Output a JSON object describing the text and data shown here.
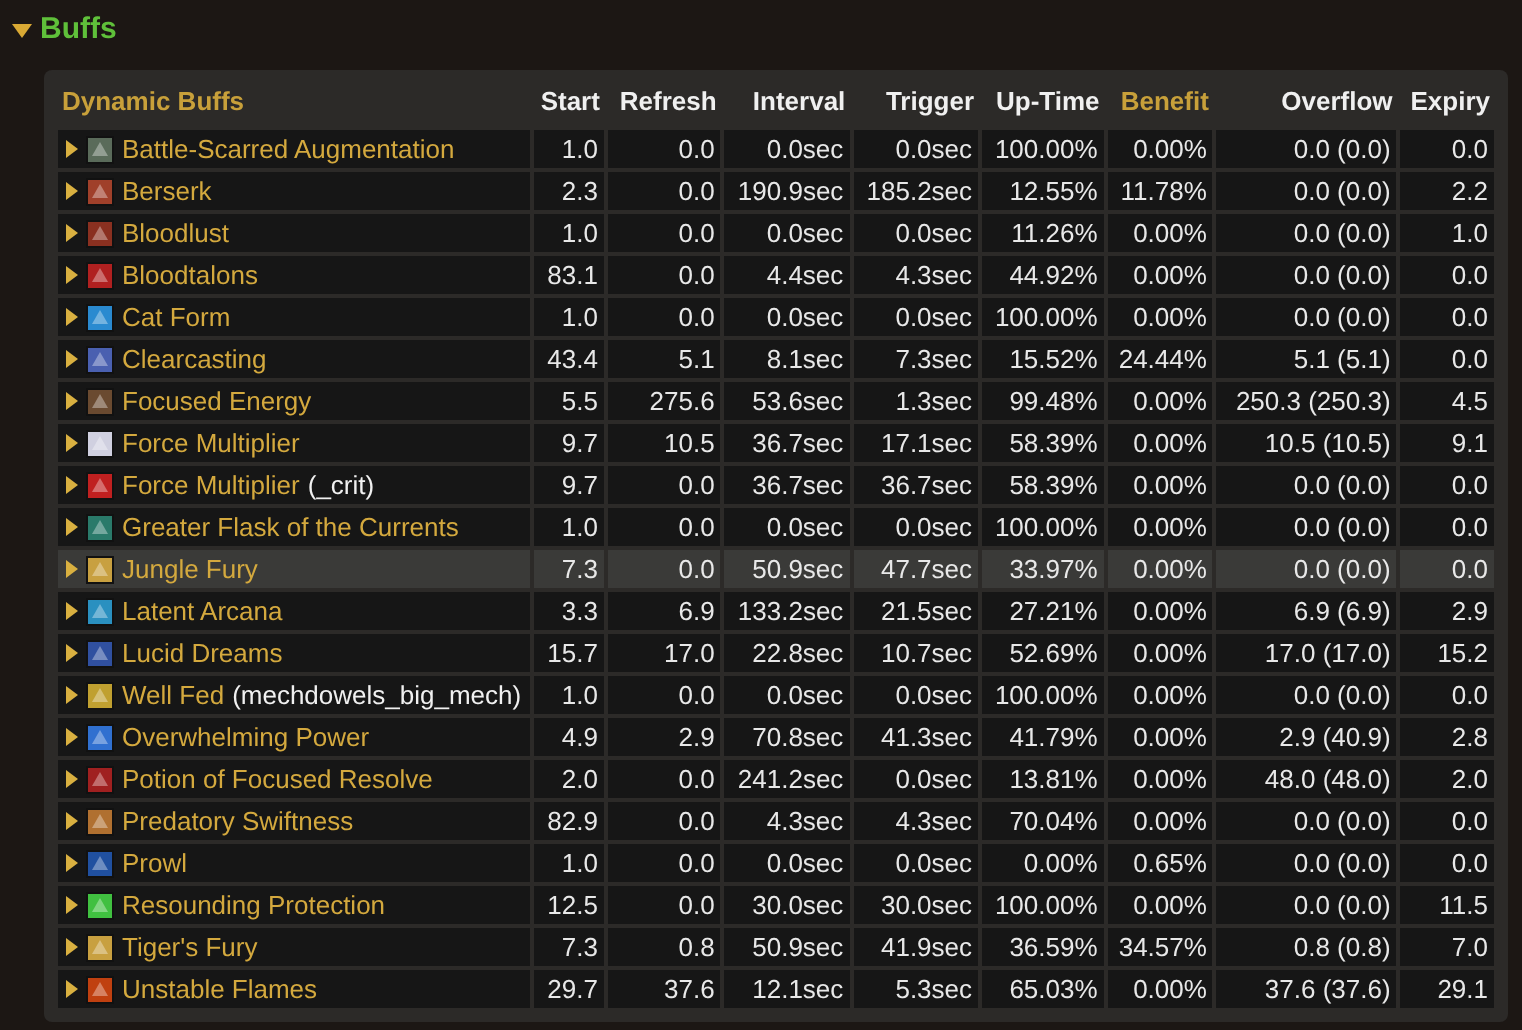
{
  "section": {
    "title": "Buffs",
    "expanded": true
  },
  "table": {
    "name_header": {
      "label": "Dynamic Buffs",
      "highlight": true
    },
    "columns": [
      {
        "label": "Start",
        "highlight": false
      },
      {
        "label": "Refresh",
        "highlight": false
      },
      {
        "label": "Interval",
        "highlight": false
      },
      {
        "label": "Trigger",
        "highlight": false
      },
      {
        "label": "Up-Time",
        "highlight": false
      },
      {
        "label": "Benefit",
        "highlight": true
      },
      {
        "label": "Overflow",
        "highlight": false
      },
      {
        "label": "Expiry",
        "highlight": false
      }
    ],
    "rows": [
      {
        "name": "Battle-Scarred Augmentation",
        "cells": [
          "1.0",
          "0.0",
          "0.0sec",
          "0.0sec",
          "100.00%",
          "0.00%",
          "0.0 (0.0)",
          "0.0"
        ],
        "selected": false
      },
      {
        "name": "Berserk",
        "cells": [
          "2.3",
          "0.0",
          "190.9sec",
          "185.2sec",
          "12.55%",
          "11.78%",
          "0.0 (0.0)",
          "2.2"
        ],
        "selected": false
      },
      {
        "name": "Bloodlust",
        "cells": [
          "1.0",
          "0.0",
          "0.0sec",
          "0.0sec",
          "11.26%",
          "0.00%",
          "0.0 (0.0)",
          "1.0"
        ],
        "selected": false
      },
      {
        "name": "Bloodtalons",
        "cells": [
          "83.1",
          "0.0",
          "4.4sec",
          "4.3sec",
          "44.92%",
          "0.00%",
          "0.0 (0.0)",
          "0.0"
        ],
        "selected": false
      },
      {
        "name": "Cat Form",
        "cells": [
          "1.0",
          "0.0",
          "0.0sec",
          "0.0sec",
          "100.00%",
          "0.00%",
          "0.0 (0.0)",
          "0.0"
        ],
        "selected": false
      },
      {
        "name": "Clearcasting",
        "cells": [
          "43.4",
          "5.1",
          "8.1sec",
          "7.3sec",
          "15.52%",
          "24.44%",
          "5.1 (5.1)",
          "0.0"
        ],
        "selected": false
      },
      {
        "name": "Focused Energy",
        "cells": [
          "5.5",
          "275.6",
          "53.6sec",
          "1.3sec",
          "99.48%",
          "0.00%",
          "250.3 (250.3)",
          "4.5"
        ],
        "selected": false
      },
      {
        "name": "Force Multiplier",
        "cells": [
          "9.7",
          "10.5",
          "36.7sec",
          "17.1sec",
          "58.39%",
          "0.00%",
          "10.5 (10.5)",
          "9.1"
        ],
        "selected": false
      },
      {
        "name": "Force Multiplier",
        "suffix": "(_crit)",
        "cells": [
          "9.7",
          "0.0",
          "36.7sec",
          "36.7sec",
          "58.39%",
          "0.00%",
          "0.0 (0.0)",
          "0.0"
        ],
        "selected": false
      },
      {
        "name": "Greater Flask of the Currents",
        "cells": [
          "1.0",
          "0.0",
          "0.0sec",
          "0.0sec",
          "100.00%",
          "0.00%",
          "0.0 (0.0)",
          "0.0"
        ],
        "selected": false
      },
      {
        "name": "Jungle Fury",
        "cells": [
          "7.3",
          "0.0",
          "50.9sec",
          "47.7sec",
          "33.97%",
          "0.00%",
          "0.0 (0.0)",
          "0.0"
        ],
        "selected": true
      },
      {
        "name": "Latent Arcana",
        "cells": [
          "3.3",
          "6.9",
          "133.2sec",
          "21.5sec",
          "27.21%",
          "0.00%",
          "6.9 (6.9)",
          "2.9"
        ],
        "selected": false
      },
      {
        "name": "Lucid Dreams",
        "cells": [
          "15.7",
          "17.0",
          "22.8sec",
          "10.7sec",
          "52.69%",
          "0.00%",
          "17.0 (17.0)",
          "15.2"
        ],
        "selected": false
      },
      {
        "name": "Well Fed",
        "suffix": "(mechdowels_big_mech)",
        "cells": [
          "1.0",
          "0.0",
          "0.0sec",
          "0.0sec",
          "100.00%",
          "0.00%",
          "0.0 (0.0)",
          "0.0"
        ],
        "selected": false
      },
      {
        "name": "Overwhelming Power",
        "cells": [
          "4.9",
          "2.9",
          "70.8sec",
          "41.3sec",
          "41.79%",
          "0.00%",
          "2.9 (40.9)",
          "2.8"
        ],
        "selected": false
      },
      {
        "name": "Potion of Focused Resolve",
        "cells": [
          "2.0",
          "0.0",
          "241.2sec",
          "0.0sec",
          "13.81%",
          "0.00%",
          "48.0 (48.0)",
          "2.0"
        ],
        "selected": false
      },
      {
        "name": "Predatory Swiftness",
        "cells": [
          "82.9",
          "0.0",
          "4.3sec",
          "4.3sec",
          "70.04%",
          "0.00%",
          "0.0 (0.0)",
          "0.0"
        ],
        "selected": false
      },
      {
        "name": "Prowl",
        "cells": [
          "1.0",
          "0.0",
          "0.0sec",
          "0.0sec",
          "0.00%",
          "0.65%",
          "0.0 (0.0)",
          "0.0"
        ],
        "selected": false
      },
      {
        "name": "Resounding Protection",
        "cells": [
          "12.5",
          "0.0",
          "30.0sec",
          "30.0sec",
          "100.00%",
          "0.00%",
          "0.0 (0.0)",
          "11.5"
        ],
        "selected": false
      },
      {
        "name": "Tiger's Fury",
        "cells": [
          "7.3",
          "0.8",
          "50.9sec",
          "41.9sec",
          "36.59%",
          "34.57%",
          "0.8 (0.8)",
          "7.0"
        ],
        "selected": false
      },
      {
        "name": "Unstable Flames",
        "cells": [
          "29.7",
          "37.6",
          "12.1sec",
          "5.3sec",
          "65.03%",
          "0.00%",
          "37.6 (37.6)",
          "29.1"
        ],
        "selected": false
      }
    ]
  }
}
